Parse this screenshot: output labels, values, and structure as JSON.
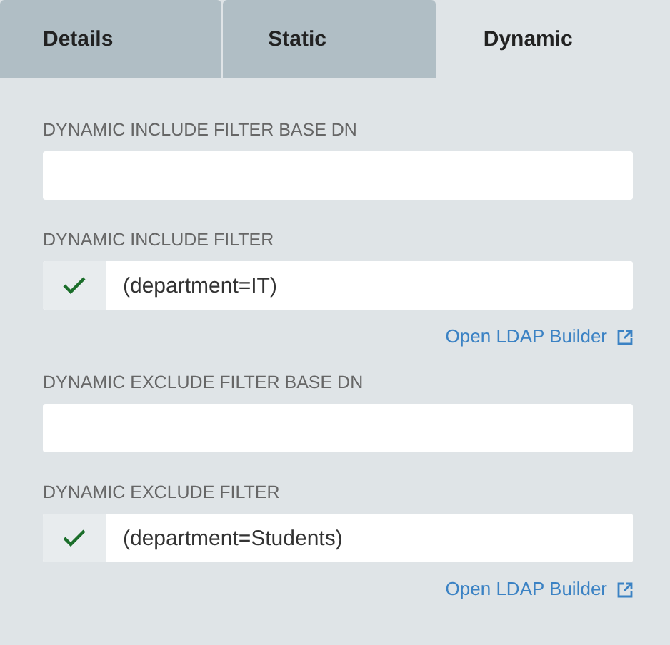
{
  "tabs": [
    {
      "label": "Details",
      "selected": false
    },
    {
      "label": "Static",
      "selected": false
    },
    {
      "label": "Dynamic",
      "selected": true
    }
  ],
  "fields": [
    {
      "kind": "text",
      "label": "DYNAMIC INCLUDE FILTER BASE DN"
    },
    {
      "kind": "filter",
      "label": "DYNAMIC INCLUDE FILTER",
      "value": "(department=IT)",
      "valid": true,
      "link": "Open LDAP Builder"
    },
    {
      "kind": "text",
      "label": "DYNAMIC EXCLUDE FILTER BASE DN"
    },
    {
      "kind": "filter",
      "label": "DYNAMIC EXCLUDE FILTER",
      "value": "(department=Students)",
      "valid": true,
      "link": "Open LDAP Builder"
    }
  ]
}
